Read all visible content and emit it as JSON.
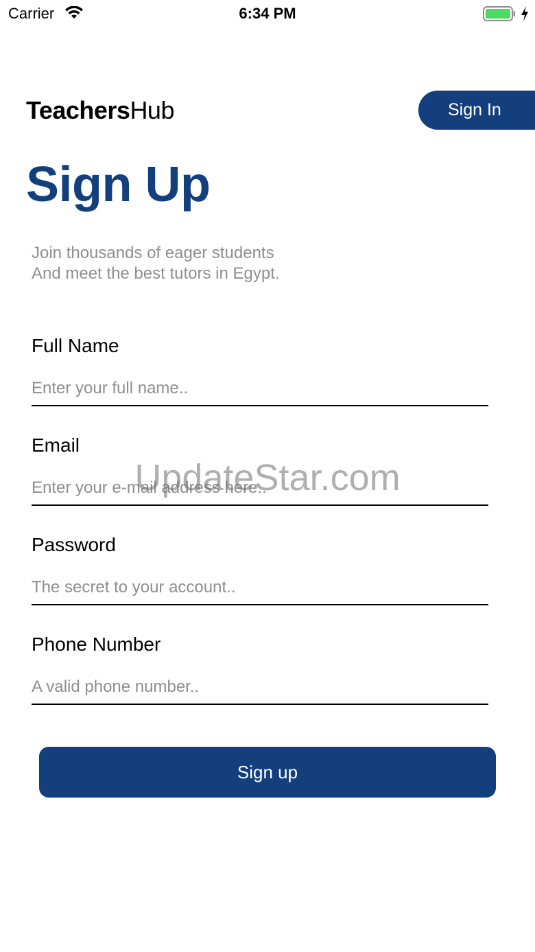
{
  "status_bar": {
    "carrier": "Carrier",
    "time": "6:34 PM",
    "battery_color": "#4cd964"
  },
  "header": {
    "brand_strong": "Teachers",
    "brand_light": "Hub",
    "signin_label": "Sign In"
  },
  "main": {
    "title": "Sign Up",
    "subtitle_line1": "Join thousands of eager students",
    "subtitle_line2": "And meet the best tutors in Egypt."
  },
  "form": {
    "full_name": {
      "label": "Full Name",
      "value": "",
      "placeholder": "Enter your full name.."
    },
    "email": {
      "label": "Email",
      "value": "",
      "placeholder": "Enter your e-mail address here.."
    },
    "password": {
      "label": "Password",
      "value": "",
      "placeholder": "The secret to your account.."
    },
    "phone": {
      "label": "Phone Number",
      "value": "",
      "placeholder": "A valid phone number.."
    },
    "submit_label": "Sign up"
  },
  "watermark": "UpdateStar.com",
  "colors": {
    "primary": "#133f7d",
    "muted_text": "#8e8e8e"
  }
}
